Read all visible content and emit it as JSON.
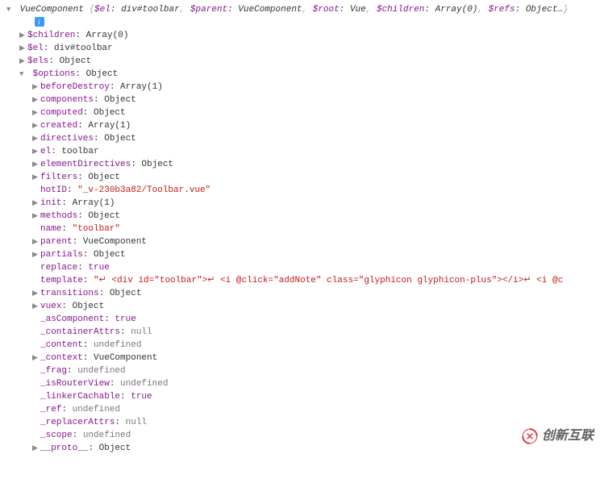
{
  "header": {
    "ctor": "VueComponent",
    "preview_pairs": [
      {
        "k": "$el",
        "v": "div#toolbar",
        "vclass": "val-obj"
      },
      {
        "k": "$parent",
        "v": "VueComponent",
        "vclass": "val-obj"
      },
      {
        "k": "$root",
        "v": "Vue",
        "vclass": "val-obj"
      },
      {
        "k": "$children",
        "v": "Array(0)",
        "vclass": "val-obj"
      },
      {
        "k": "$refs",
        "v": "Object…",
        "vclass": "val-obj"
      }
    ],
    "close": "}"
  },
  "level1": [
    {
      "arrow": "▶",
      "k": "$children",
      "v": "Array(0)",
      "vclass": "val-obj"
    },
    {
      "arrow": "▶",
      "k": "$el",
      "v": "div#toolbar",
      "vclass": "val-obj"
    },
    {
      "arrow": "▶",
      "k": "$els",
      "v": "Object",
      "vclass": "val-obj"
    }
  ],
  "options_row": {
    "arrow": "▼",
    "k": "$options",
    "v": "Object",
    "vclass": "val-obj"
  },
  "options_children": [
    {
      "arrow": "▶",
      "k": "beforeDestroy",
      "v": "Array(1)",
      "vclass": "val-obj"
    },
    {
      "arrow": "▶",
      "k": "components",
      "v": "Object",
      "vclass": "val-obj"
    },
    {
      "arrow": "▶",
      "k": "computed",
      "v": "Object",
      "vclass": "val-obj"
    },
    {
      "arrow": "▶",
      "k": "created",
      "v": "Array(1)",
      "vclass": "val-obj"
    },
    {
      "arrow": "▶",
      "k": "directives",
      "v": "Object",
      "vclass": "val-obj"
    },
    {
      "arrow": "▶",
      "k": "el",
      "v": "toolbar",
      "vclass": "val-obj"
    },
    {
      "arrow": "▶",
      "k": "elementDirectives",
      "v": "Object",
      "vclass": "val-obj"
    },
    {
      "arrow": "▶",
      "k": "filters",
      "v": "Object",
      "vclass": "val-obj"
    },
    {
      "arrow": "",
      "k": "hotID",
      "v": "\"_v-230b3a82/Toolbar.vue\"",
      "vclass": "val-str"
    },
    {
      "arrow": "▶",
      "k": "init",
      "v": "Array(1)",
      "vclass": "val-obj"
    },
    {
      "arrow": "▶",
      "k": "methods",
      "v": "Object",
      "vclass": "val-obj"
    },
    {
      "arrow": "",
      "k": "name",
      "v": "\"toolbar\"",
      "vclass": "val-str"
    },
    {
      "arrow": "▶",
      "k": "parent",
      "v": "VueComponent",
      "vclass": "val-obj"
    },
    {
      "arrow": "▶",
      "k": "partials",
      "v": "Object",
      "vclass": "val-obj"
    },
    {
      "arrow": "",
      "k": "replace",
      "v": "true",
      "vclass": "val-bool"
    },
    {
      "arrow": "",
      "k": "template",
      "v_template": true
    },
    {
      "arrow": "▶",
      "k": "transitions",
      "v": "Object",
      "vclass": "val-obj"
    },
    {
      "arrow": "▶",
      "k": "vuex",
      "v": "Object",
      "vclass": "val-obj"
    },
    {
      "arrow": "",
      "k": "_asComponent",
      "v": "true",
      "vclass": "val-bool"
    },
    {
      "arrow": "",
      "k": "_containerAttrs",
      "v": "null",
      "vclass": "val-null"
    },
    {
      "arrow": "",
      "k": "_content",
      "v": "undefined",
      "vclass": "val-undef"
    },
    {
      "arrow": "▶",
      "k": "_context",
      "v": "VueComponent",
      "vclass": "val-obj"
    },
    {
      "arrow": "",
      "k": "_frag",
      "v": "undefined",
      "vclass": "val-undef"
    },
    {
      "arrow": "",
      "k": "_isRouterView",
      "v": "undefined",
      "vclass": "val-undef"
    },
    {
      "arrow": "",
      "k": "_linkerCachable",
      "v": "true",
      "vclass": "val-bool"
    },
    {
      "arrow": "",
      "k": "_ref",
      "v": "undefined",
      "vclass": "val-undef"
    },
    {
      "arrow": "",
      "k": "_replacerAttrs",
      "v": "null",
      "vclass": "val-null"
    },
    {
      "arrow": "",
      "k": "_scope",
      "v": "undefined",
      "vclass": "val-undef"
    },
    {
      "arrow": "▶",
      "k": "__proto__",
      "v": "Object",
      "vclass": "val-obj"
    }
  ],
  "template_segments": [
    {
      "t": "\"",
      "c": "val-str"
    },
    {
      "t": "↵",
      "c": "trail-arrow"
    },
    {
      "t": "   <div id=\"toolbar\">",
      "c": "val-str"
    },
    {
      "t": "↵",
      "c": "trail-arrow"
    },
    {
      "t": "    <i @click=\"addNote\" class=\"glyphicon glyphicon-plus\"></i>",
      "c": "val-str"
    },
    {
      "t": "↵",
      "c": "trail-arrow"
    },
    {
      "t": "    <i @c",
      "c": "val-str"
    }
  ],
  "watermark_text": "创新互联"
}
